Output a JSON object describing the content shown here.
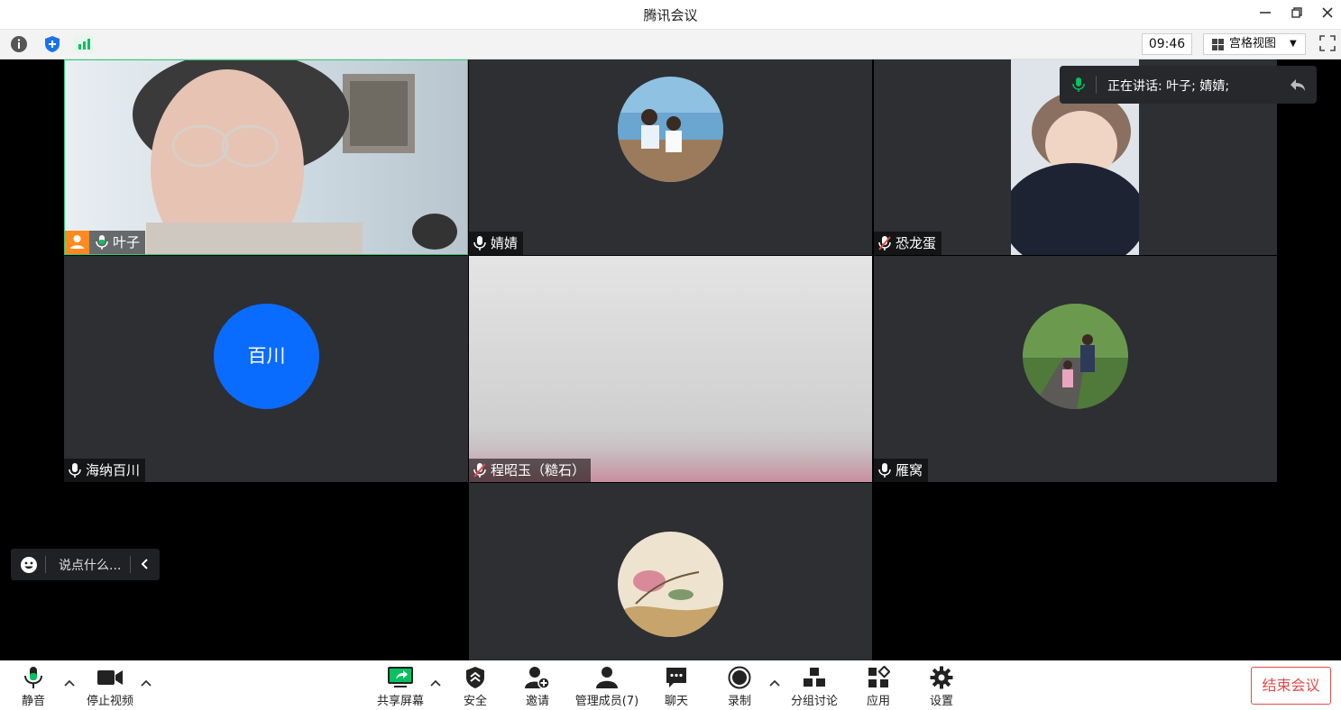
{
  "window": {
    "title": "腾讯会议"
  },
  "infobar": {
    "time": "09:46",
    "view_label": "宫格视图"
  },
  "speaking": {
    "label": "正在讲话: 叶子; 婧婧;"
  },
  "chat": {
    "placeholder": "说点什么..."
  },
  "participants": [
    {
      "name": "叶子",
      "mic": "on",
      "host": true
    },
    {
      "name": "婧婧",
      "mic": "on"
    },
    {
      "name": "恐龙蛋",
      "mic": "muted"
    },
    {
      "name": "海纳百川",
      "mic": "on",
      "avatar_text": "百川"
    },
    {
      "name": "程昭玉（糙石）",
      "mic": "muted"
    },
    {
      "name": "雁窝",
      "mic": "on"
    }
  ],
  "toolbar": {
    "mute": "静音",
    "video": "停止视频",
    "share": "共享屏幕",
    "security": "安全",
    "invite": "邀请",
    "members": "管理成员(7)",
    "chat": "聊天",
    "record": "录制",
    "breakout": "分组讨论",
    "apps": "应用",
    "settings": "设置",
    "end": "结束会议"
  },
  "colors": {
    "accent_green": "#07c160",
    "accent_blue": "#0a6cff",
    "end_red": "#e34a4a",
    "host_orange": "#ff8a1f"
  }
}
